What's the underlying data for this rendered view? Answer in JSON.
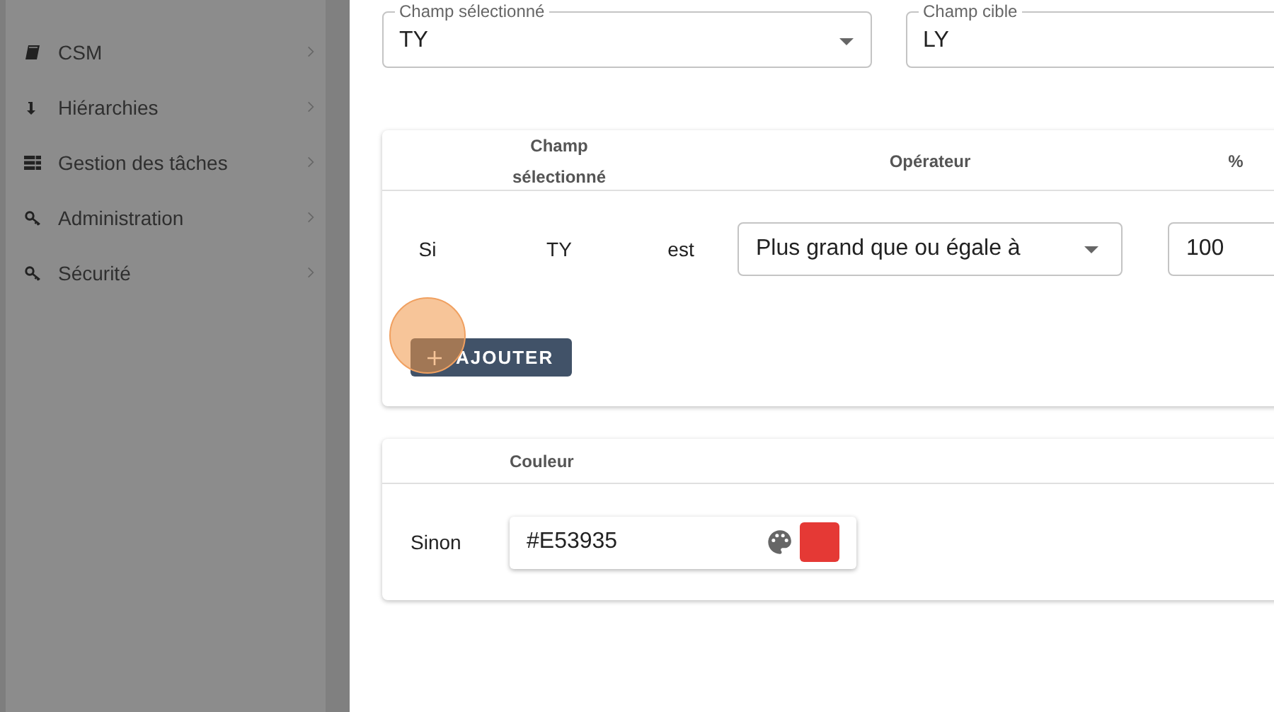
{
  "sidebar": {
    "items": [
      {
        "label": "CSM"
      },
      {
        "label": "Hiérarchies"
      },
      {
        "label": "Gestion des tâches"
      },
      {
        "label": "Administration"
      },
      {
        "label": "Sécurité"
      }
    ]
  },
  "fields": [
    {
      "label": "Champ sélectionné",
      "value": "TY"
    },
    {
      "label": "Champ cible",
      "value": "LY"
    }
  ],
  "rules_table": {
    "columns": [
      "Champ sélectionné",
      "Opérateur",
      "%"
    ],
    "rows": [
      {
        "prefix": "Si",
        "field": "TY",
        "verb": "est",
        "operator": "Plus grand que ou égale à",
        "percent": "100"
      }
    ],
    "add_button": "AJOUTER"
  },
  "else_table": {
    "columns": [
      "Couleur"
    ],
    "rows": [
      {
        "label": "Sinon",
        "color_value": "#E53935",
        "color": "#e53935"
      }
    ]
  }
}
